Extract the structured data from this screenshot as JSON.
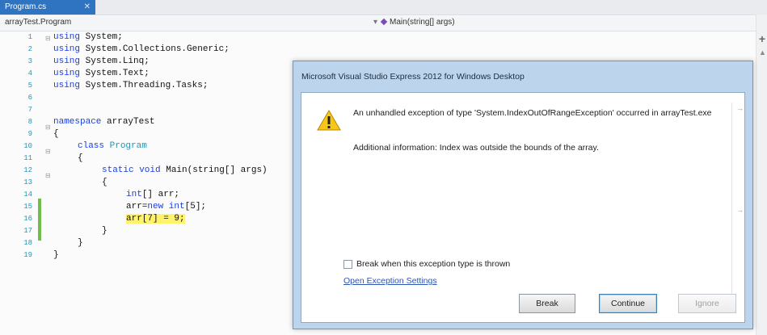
{
  "editor": {
    "tab_title": "Program.cs",
    "tab_close": "✕",
    "nav_class": "arrayTest.Program",
    "nav_method_arrow": "▾",
    "nav_method": "Main(string[] args)",
    "scroll_plus": "+",
    "scroll_arrow": "▲",
    "line_numbers": [
      "1",
      "2",
      "3",
      "4",
      "5",
      "6",
      "7",
      "8",
      "9",
      "10",
      "11",
      "12",
      "13",
      "14",
      "15",
      "16",
      "17",
      "18",
      "19"
    ],
    "lines": [
      {
        "kw": "using",
        "rest": " System;"
      },
      {
        "kw": "using",
        "rest": " System.Collections.Generic;"
      },
      {
        "kw": "using",
        "rest": " System.Linq;"
      },
      {
        "kw": "using",
        "rest": " System.Text;"
      },
      {
        "kw": "using",
        "rest": " System.Threading.Tasks;"
      },
      {
        "kw": "namespace",
        "rest": " arrayTest"
      },
      {
        "text": "{"
      },
      {
        "kw": "class",
        "ty": " Program"
      },
      {
        "text": "{"
      },
      {
        "kw": "static void",
        "rest": " Main(string[] args)"
      },
      {
        "text": "{"
      },
      {
        "kw": "int",
        "rest": "[] arr;"
      },
      {
        "pre": "arr=",
        "kw": "new int",
        "rest": "[5];"
      },
      {
        "hl": "arr[7] = 9;"
      },
      {
        "text": "}"
      },
      {
        "text": "}"
      },
      {
        "text": "}"
      }
    ]
  },
  "dialog": {
    "title": "Microsoft Visual Studio Express 2012 for Windows Desktop",
    "message": "An unhandled exception of type 'System.IndexOutOfRangeException' occurred in arrayTest.exe",
    "additional_info": "Additional information: Index was outside the bounds of the array.",
    "arrow_glyph": "→",
    "checkbox_label": "Break when this exception type is thrown",
    "link_text": "Open Exception Settings",
    "buttons": {
      "break": "Break",
      "continue": "Continue",
      "ignore": "Ignore"
    }
  }
}
